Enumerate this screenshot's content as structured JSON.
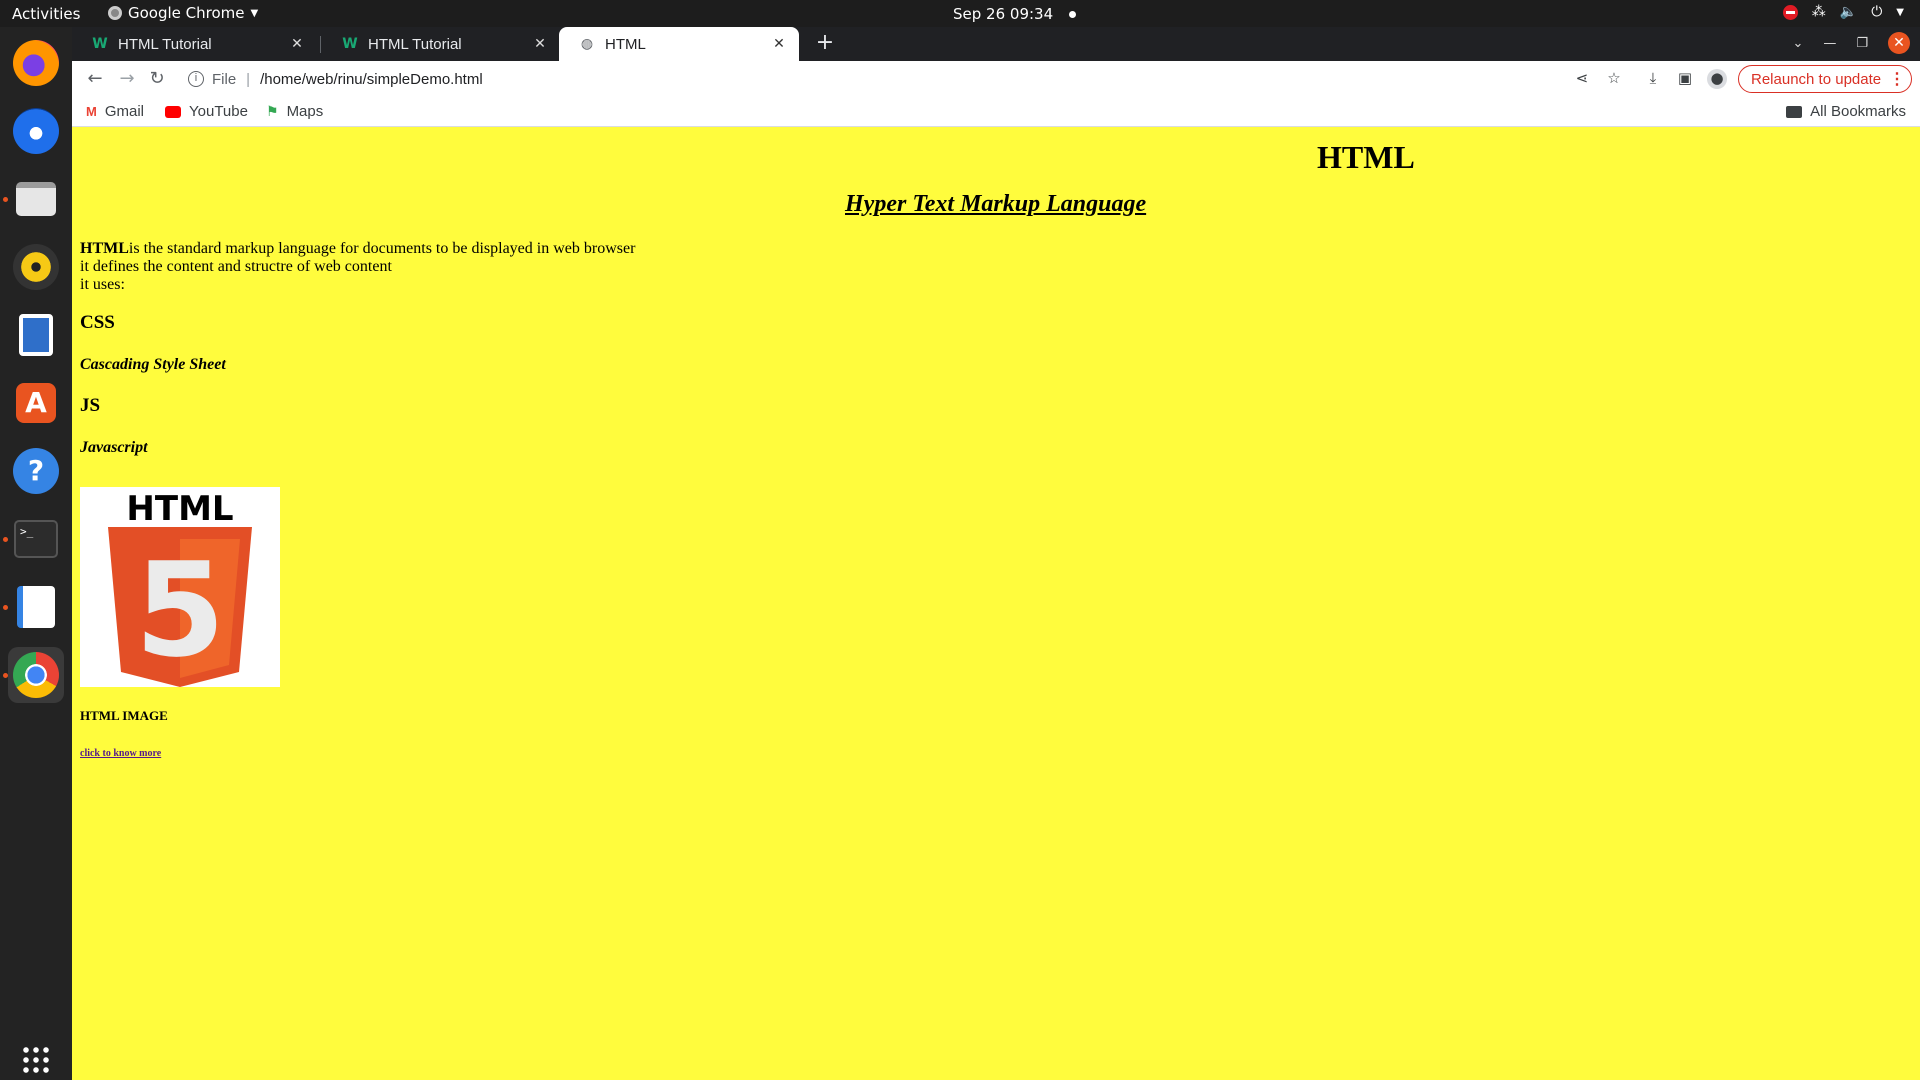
{
  "system": {
    "activities": "Activities",
    "app_name": "Google Chrome",
    "clock": "Sep 26  09:34"
  },
  "browser": {
    "tabs": [
      {
        "title": "HTML Tutorial",
        "favicon": "w3schools-icon",
        "active": false
      },
      {
        "title": "HTML Tutorial",
        "favicon": "w3schools-icon",
        "active": false
      },
      {
        "title": "HTML",
        "favicon": "globe-icon",
        "active": true
      }
    ],
    "address": {
      "scheme": "File",
      "url": "/home/web/rinu/simpleDemo.html"
    },
    "relaunch_label": "Relaunch to update",
    "bookmarks": [
      {
        "label": "Gmail",
        "icon": "gmail-icon"
      },
      {
        "label": "YouTube",
        "icon": "youtube-icon"
      },
      {
        "label": "Maps",
        "icon": "maps-icon"
      }
    ],
    "all_bookmarks": "All Bookmarks"
  },
  "page": {
    "background": "#fffc3d",
    "title": "HTML",
    "subtitle": "Hyper Text Markup Language",
    "intro_bold": "HTML",
    "intro_rest": "is the standard markup language for documents to be displayed in web browser",
    "line2": "it defines the content and structre of web content",
    "line3": "it uses:",
    "css_heading": "CSS",
    "css_desc": "Cascading Style Sheet",
    "js_heading": "JS",
    "js_desc": "Javascript",
    "logo_text": "HTML",
    "logo_digit": "5",
    "image_caption": "HTML IMAGE",
    "link_text": "click to know more"
  }
}
